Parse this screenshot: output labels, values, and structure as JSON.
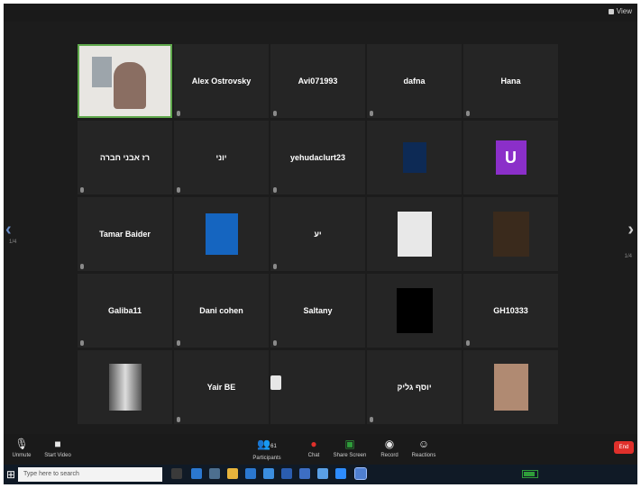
{
  "top_bar": {
    "view_label": "View"
  },
  "navigation": {
    "prev_page": "‹",
    "next_page": "›",
    "page_left": "1/4",
    "page_right": "1/4"
  },
  "participants": [
    {
      "kind": "video",
      "label": ""
    },
    {
      "kind": "name",
      "name": "Alex Ostrovsky"
    },
    {
      "kind": "name",
      "name": "Avi071993"
    },
    {
      "kind": "name",
      "name": "dafna"
    },
    {
      "kind": "name",
      "name": "Hana"
    },
    {
      "kind": "name",
      "name": "רז אבני חברה"
    },
    {
      "kind": "name",
      "name": "יוני"
    },
    {
      "kind": "name",
      "name": "yehudaclurt23"
    },
    {
      "kind": "image",
      "image": "logo-avatar",
      "label": ""
    },
    {
      "kind": "letter",
      "letter": "U",
      "label": ""
    },
    {
      "kind": "name",
      "name": "Tamar Baider"
    },
    {
      "kind": "image",
      "image": "moon-avatar",
      "label": ""
    },
    {
      "kind": "name",
      "name": "יע"
    },
    {
      "kind": "image",
      "image": "character-avatar",
      "label": ""
    },
    {
      "kind": "image",
      "image": "flowers-avatar",
      "label": ""
    },
    {
      "kind": "name",
      "name": "Galiba11"
    },
    {
      "kind": "name",
      "name": "Dani cohen"
    },
    {
      "kind": "name",
      "name": "Saltany"
    },
    {
      "kind": "image",
      "image": "black-avatar",
      "label": ""
    },
    {
      "kind": "name",
      "name": "GH10333"
    },
    {
      "kind": "image",
      "image": "blurred-avatar",
      "label": ""
    },
    {
      "kind": "name",
      "name": "Yair BE"
    },
    {
      "kind": "status",
      "text": ""
    },
    {
      "kind": "name",
      "name": "יוסף גליק"
    },
    {
      "kind": "image",
      "image": "person-avatar",
      "label": ""
    }
  ],
  "toolbar": {
    "mute": {
      "icon": "microphone-icon",
      "label": "Unmute"
    },
    "video": {
      "icon": "video-camera-icon",
      "label": "Start Video"
    },
    "participants": {
      "icon": "participants-icon",
      "label": "Participants",
      "count": "61"
    },
    "chat": {
      "icon": "chat-icon",
      "label": "Chat"
    },
    "share": {
      "icon": "share-screen-icon",
      "label": "Share Screen"
    },
    "record": {
      "icon": "record-icon",
      "label": "Record"
    },
    "reactions": {
      "icon": "reactions-icon",
      "label": "Reactions"
    },
    "end": {
      "label": "End"
    }
  },
  "taskbar": {
    "search_placeholder": "Type here to search",
    "clock_time": "",
    "clock_date": ""
  },
  "colors": {
    "accent_green": "#2f9c3a",
    "end_red": "#e0302b",
    "avatar_purple": "#8b2fc9",
    "avatar_blue": "#1565c0"
  }
}
